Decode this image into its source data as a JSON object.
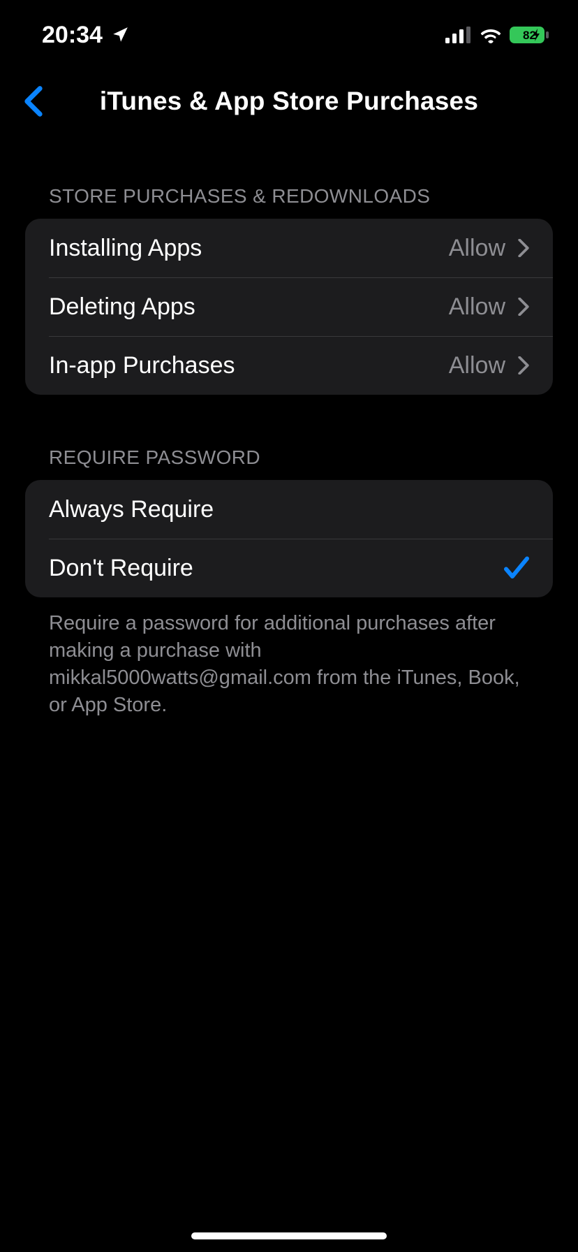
{
  "status_bar": {
    "time": "20:34",
    "battery_level": "82"
  },
  "nav": {
    "title": "iTunes & App Store Purchases"
  },
  "sections": {
    "store": {
      "header": "STORE PURCHASES & REDOWNLOADS",
      "rows": [
        {
          "label": "Installing Apps",
          "value": "Allow"
        },
        {
          "label": "Deleting Apps",
          "value": "Allow"
        },
        {
          "label": "In-app Purchases",
          "value": "Allow"
        }
      ]
    },
    "password": {
      "header": "REQUIRE PASSWORD",
      "rows": [
        {
          "label": "Always Require"
        },
        {
          "label": "Don't Require"
        }
      ],
      "footer": "Require a password for additional purchases after making a purchase with mikkal5000watts@gmail.com from the iTunes, Book, or App Store."
    }
  }
}
